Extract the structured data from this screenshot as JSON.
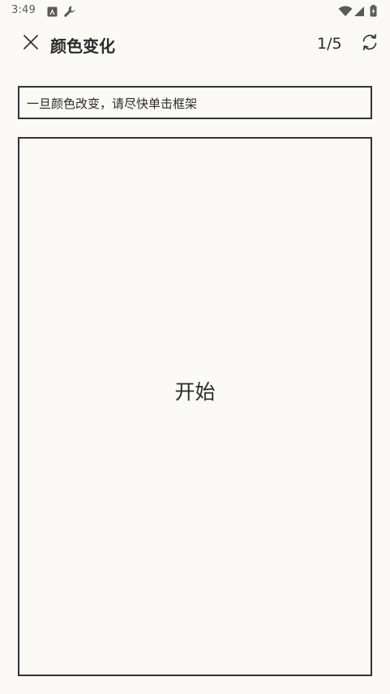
{
  "status_bar": {
    "time": "3:49",
    "icons": [
      "accessibility-icon",
      "wrench-icon",
      "wifi-icon",
      "cell-signal-icon",
      "battery-icon"
    ]
  },
  "app_bar": {
    "title": "颜色变化",
    "progress": "1/5",
    "close_icon": "close-icon",
    "restart_icon": "restart-icon"
  },
  "instruction": {
    "text": "一旦颜色改变，请尽快单击框架"
  },
  "frame": {
    "start_label": "开始"
  },
  "colors": {
    "background": "#faf9f5",
    "border": "#333333",
    "text": "#2b2b2b"
  }
}
